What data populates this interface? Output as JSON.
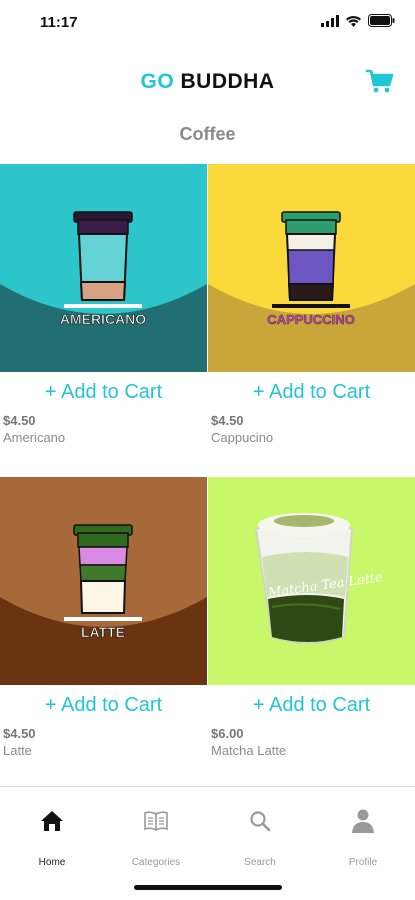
{
  "status": {
    "time": "11:17"
  },
  "header": {
    "logo_go": "GO",
    "logo_rest": "BUDDHA",
    "cart_icon": "cart-icon"
  },
  "section": {
    "title": "Coffee"
  },
  "products": [
    {
      "badge": "AMERICANO",
      "add_label": "+ Add to Cart",
      "price": "$4.50",
      "name": "Americano"
    },
    {
      "badge": "CAPPUCCINO",
      "add_label": "+ Add to Cart",
      "price": "$4.50",
      "name": "Cappucino"
    },
    {
      "badge": "LATTE",
      "add_label": "+ Add to Cart",
      "price": "$4.50",
      "name": "Latte"
    },
    {
      "badge": "Matcha Tea Latte",
      "add_label": "+ Add to Cart",
      "price": "$6.00",
      "name": "Matcha Latte"
    }
  ],
  "tabs": [
    {
      "label": "Home",
      "icon": "home-icon",
      "active": true
    },
    {
      "label": "Categories",
      "icon": "book-icon",
      "active": false
    },
    {
      "label": "Search",
      "icon": "search-icon",
      "active": false
    },
    {
      "label": "Profile",
      "icon": "person-icon",
      "active": false
    }
  ],
  "colors": {
    "accent": "#22c6d3",
    "americano_bg": "#2cc5c9",
    "cappuccino_bg": "#fbd93a",
    "latte_bg": "#a8693a",
    "matcha_bg": "#c8f76a"
  }
}
